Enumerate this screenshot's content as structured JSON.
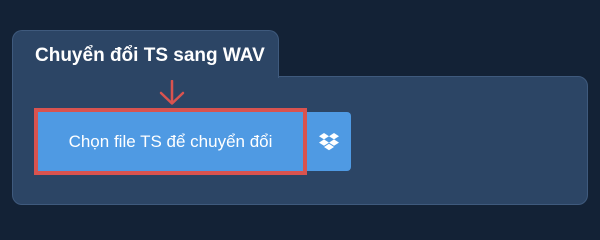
{
  "tab": {
    "title": "Chuyển đổi TS sang WAV"
  },
  "upload": {
    "button_label": "Chọn file TS để chuyển đổi",
    "dropbox_icon": "dropbox-icon"
  },
  "colors": {
    "background": "#132236",
    "panel": "#2c4565",
    "button": "#4f9ae3",
    "highlight": "#d9534f"
  }
}
